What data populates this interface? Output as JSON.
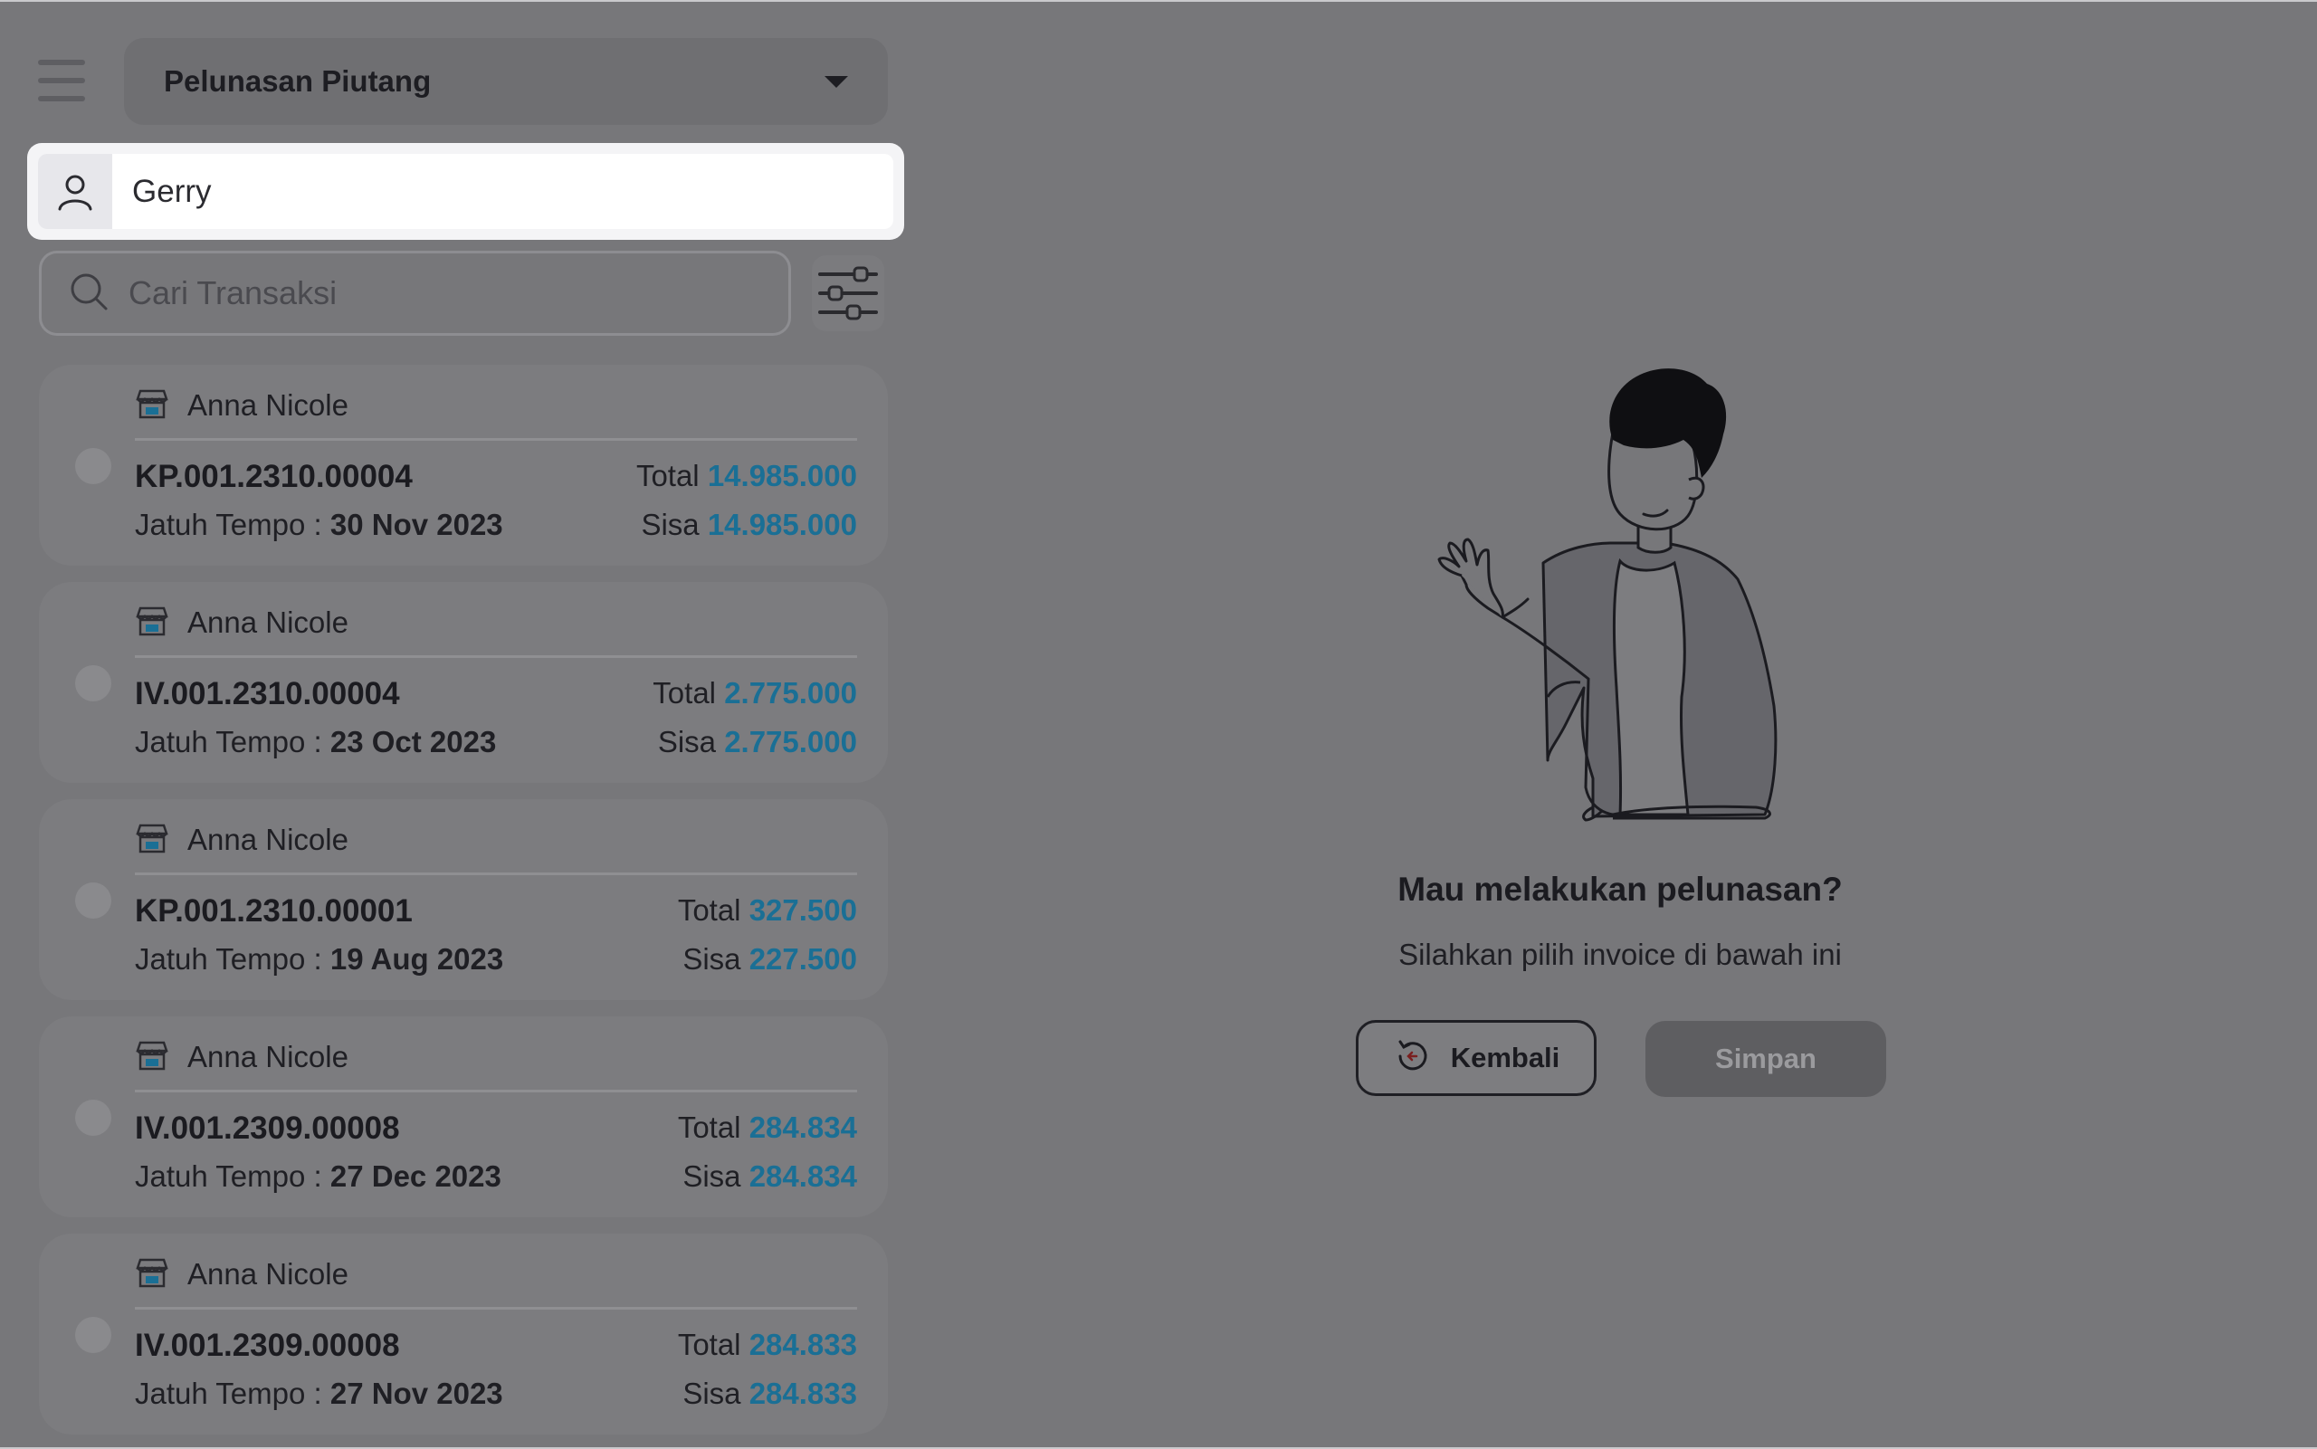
{
  "header": {
    "module_title": "Pelunasan Piutang"
  },
  "customer": {
    "name": "Gerry"
  },
  "search": {
    "placeholder": "Cari Transaksi"
  },
  "labels": {
    "due": "Jatuh Tempo :",
    "total": "Total",
    "sisa": "Sisa"
  },
  "invoices": [
    {
      "store": "Anna Nicole",
      "number": "KP.001.2310.00004",
      "due_date": "30 Nov 2023",
      "total": "14.985.000",
      "sisa": "14.985.000"
    },
    {
      "store": "Anna Nicole",
      "number": "IV.001.2310.00004",
      "due_date": "23 Oct 2023",
      "total": "2.775.000",
      "sisa": "2.775.000"
    },
    {
      "store": "Anna Nicole",
      "number": "KP.001.2310.00001",
      "due_date": "19 Aug 2023",
      "total": "327.500",
      "sisa": "227.500"
    },
    {
      "store": "Anna Nicole",
      "number": "IV.001.2309.00008",
      "due_date": "27 Dec 2023",
      "total": "284.834",
      "sisa": "284.834"
    },
    {
      "store": "Anna Nicole",
      "number": "IV.001.2309.00008",
      "due_date": "27 Nov 2023",
      "total": "284.833",
      "sisa": "284.833"
    }
  ],
  "empty_state": {
    "title": "Mau melakukan pelunasan?",
    "subtitle": "Silahkan pilih invoice di bawah ini"
  },
  "actions": {
    "back_label": "Kembali",
    "save_label": "Simpan"
  },
  "colors": {
    "accent_amount": "#1a6f95",
    "overlay_background": "#77777a"
  }
}
